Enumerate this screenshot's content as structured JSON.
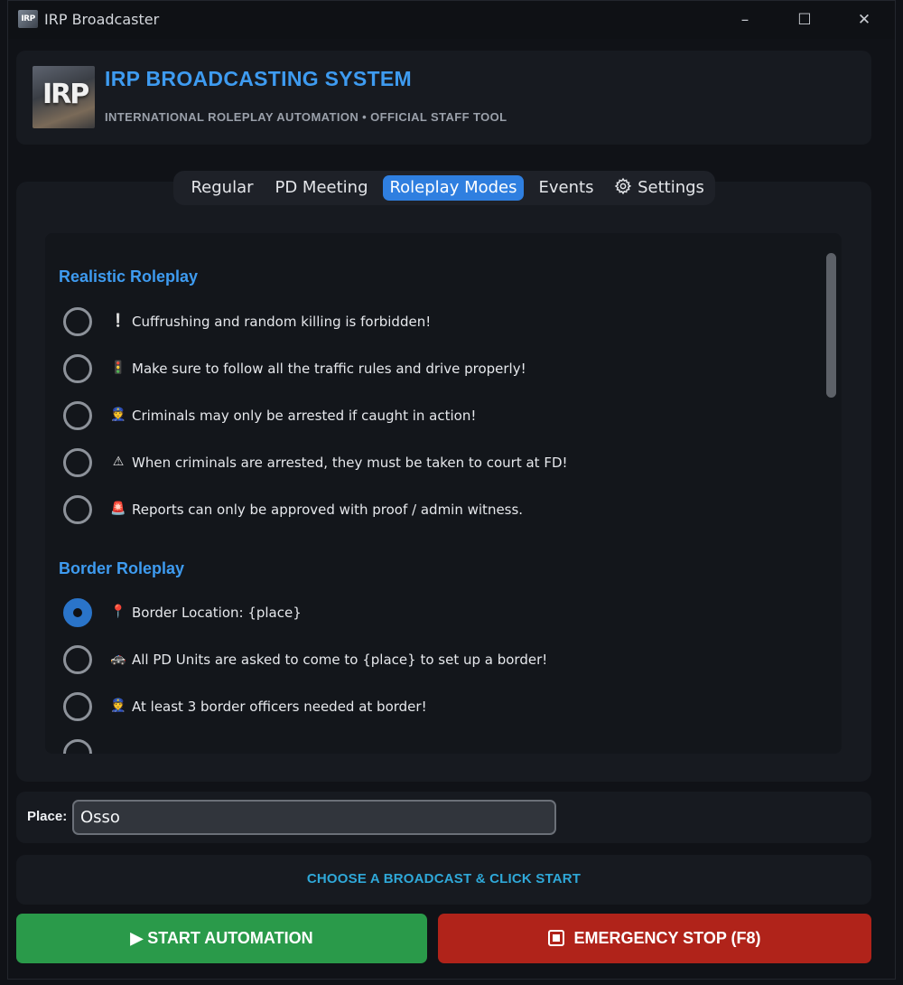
{
  "window": {
    "title": "IRP Broadcaster",
    "icon_name": "irp-app-icon",
    "icon_text": "IRP",
    "controls": {
      "minimize": "–",
      "maximize": "☐",
      "close": "✕"
    }
  },
  "header": {
    "logo_text": "IRP",
    "title": "IRP BROADCASTING SYSTEM",
    "subtitle": "INTERNATIONAL ROLEPLAY AUTOMATION • OFFICIAL STAFF TOOL"
  },
  "tabs": [
    {
      "label": "Regular",
      "active": false
    },
    {
      "label": "PD Meeting",
      "active": false
    },
    {
      "label": "Roleplay Modes",
      "active": true
    },
    {
      "label": "Events",
      "active": false
    },
    {
      "label": "Settings",
      "active": false,
      "icon": "gear-icon"
    }
  ],
  "sections": [
    {
      "title": "Realistic Roleplay",
      "options": [
        {
          "icon": "exclamation-icon",
          "glyph": "❕",
          "label": "Cuffrushing and random killing is forbidden!",
          "checked": false
        },
        {
          "icon": "traffic-light-icon",
          "glyph": "🚦",
          "label": "Make sure to follow all the traffic rules and drive properly!",
          "checked": false
        },
        {
          "icon": "police-officer-icon",
          "glyph": "👮",
          "label": "Criminals may only be arrested if caught in action!",
          "checked": false
        },
        {
          "icon": "warning-icon",
          "glyph": "⚠",
          "label": "When criminals are arrested, they must be taken to court at FD!",
          "checked": false
        },
        {
          "icon": "siren-icon",
          "glyph": "🚨",
          "label": "Reports can only be approved with proof / admin witness.",
          "checked": false
        }
      ]
    },
    {
      "title": "Border Roleplay",
      "options": [
        {
          "icon": "pin-icon",
          "glyph": "📍",
          "label": "Border Location: {place}",
          "checked": true
        },
        {
          "icon": "police-car-icon",
          "glyph": "🚓",
          "label": "All PD Units are asked to come to {place} to set up a border!",
          "checked": false
        },
        {
          "icon": "police-officer-icon",
          "glyph": "👮",
          "label": "At least 3 border officers needed at border!",
          "checked": false
        }
      ]
    }
  ],
  "place": {
    "label": "Place:",
    "value": "Osso"
  },
  "status": "CHOOSE A BROADCAST & CLICK START",
  "buttons": {
    "start": "▶ START AUTOMATION",
    "stop": "EMERGENCY STOP (F8)"
  },
  "colors": {
    "accent": "#3e9bf0",
    "start": "#2a9a4a",
    "stop": "#b0231a",
    "status": "#2fa8d8"
  }
}
